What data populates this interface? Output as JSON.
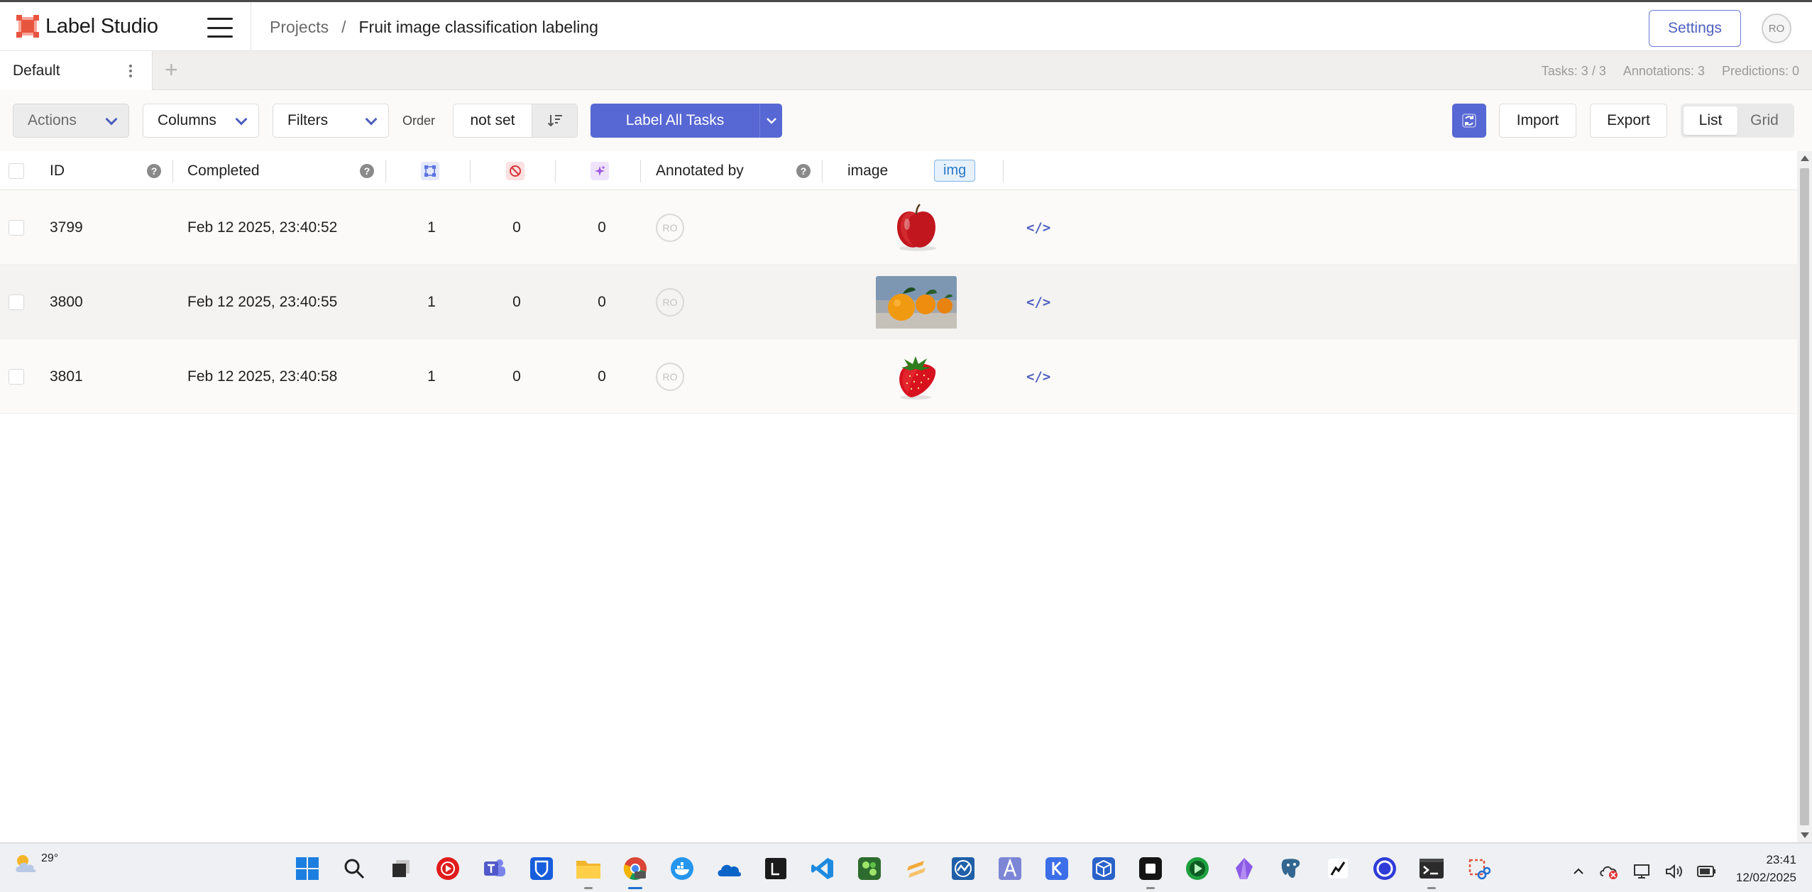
{
  "header": {
    "app_name": "Label Studio",
    "breadcrumb_projects": "Projects",
    "breadcrumb_separator": "/",
    "project_title": "Fruit image classification labeling",
    "settings_label": "Settings",
    "user_initials": "RO"
  },
  "tabs": {
    "default_label": "Default",
    "add_label": "+",
    "stats": {
      "tasks": "Tasks: 3 / 3",
      "annotations": "Annotations: 3",
      "predictions": "Predictions: 0"
    }
  },
  "toolbar": {
    "actions_label": "Actions",
    "columns_label": "Columns",
    "filters_label": "Filters",
    "order_label": "Order",
    "order_value": "not set",
    "label_all_label": "Label All Tasks",
    "import_label": "Import",
    "export_label": "Export",
    "view_list": "List",
    "view_grid": "Grid",
    "accent_color": "#5767d3"
  },
  "table": {
    "columns": {
      "id": "ID",
      "completed": "Completed",
      "annotated_by": "Annotated by",
      "image": "image",
      "image_tag": "img"
    },
    "help_glyph": "?",
    "rows": [
      {
        "id": "3799",
        "completed": "Feb 12 2025, 23:40:52",
        "annotations": "1",
        "cancelled": "0",
        "predictions": "0",
        "annotator": "RO",
        "fruit": "apple"
      },
      {
        "id": "3800",
        "completed": "Feb 12 2025, 23:40:55",
        "annotations": "1",
        "cancelled": "0",
        "predictions": "0",
        "annotator": "RO",
        "fruit": "oranges"
      },
      {
        "id": "3801",
        "completed": "Feb 12 2025, 23:40:58",
        "annotations": "1",
        "cancelled": "0",
        "predictions": "0",
        "annotator": "RO",
        "fruit": "strawberry"
      }
    ],
    "code_glyph": "</>"
  },
  "taskbar": {
    "temperature": "29°",
    "time": "23:41",
    "date": "12/02/2025"
  }
}
